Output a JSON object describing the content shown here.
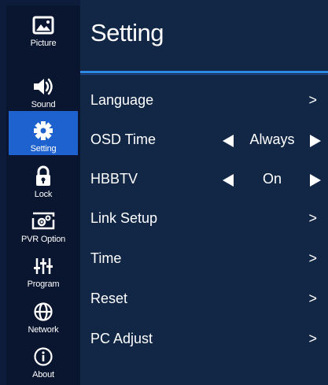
{
  "sidebar": {
    "items": [
      {
        "label": "Picture",
        "icon": "picture-icon"
      },
      {
        "label": "Sound",
        "icon": "speaker-icon"
      },
      {
        "label": "Setting",
        "icon": "gear-icon",
        "active": true
      },
      {
        "label": "Lock",
        "icon": "lock-icon"
      },
      {
        "label": "PVR Option",
        "icon": "pvr-icon"
      },
      {
        "label": "Program",
        "icon": "equalizer-icon"
      },
      {
        "label": "Network",
        "icon": "globe-icon"
      },
      {
        "label": "About",
        "icon": "info-icon"
      }
    ]
  },
  "main": {
    "title": "Setting",
    "rows": [
      {
        "label": "Language",
        "chevron": ">"
      },
      {
        "label": "OSD Time",
        "value": "Always"
      },
      {
        "label": "HBBTV",
        "value": "On"
      },
      {
        "label": "Link Setup",
        "chevron": ">"
      },
      {
        "label": "Time",
        "chevron": ">"
      },
      {
        "label": "Reset",
        "chevron": ">"
      },
      {
        "label": "PC Adjust",
        "chevron": ">"
      }
    ]
  },
  "colors": {
    "sidebar_bg": "#0a1630",
    "main_bg": "#122746",
    "active_bg": "#1d62cf",
    "divider": "#2f8ae6"
  }
}
